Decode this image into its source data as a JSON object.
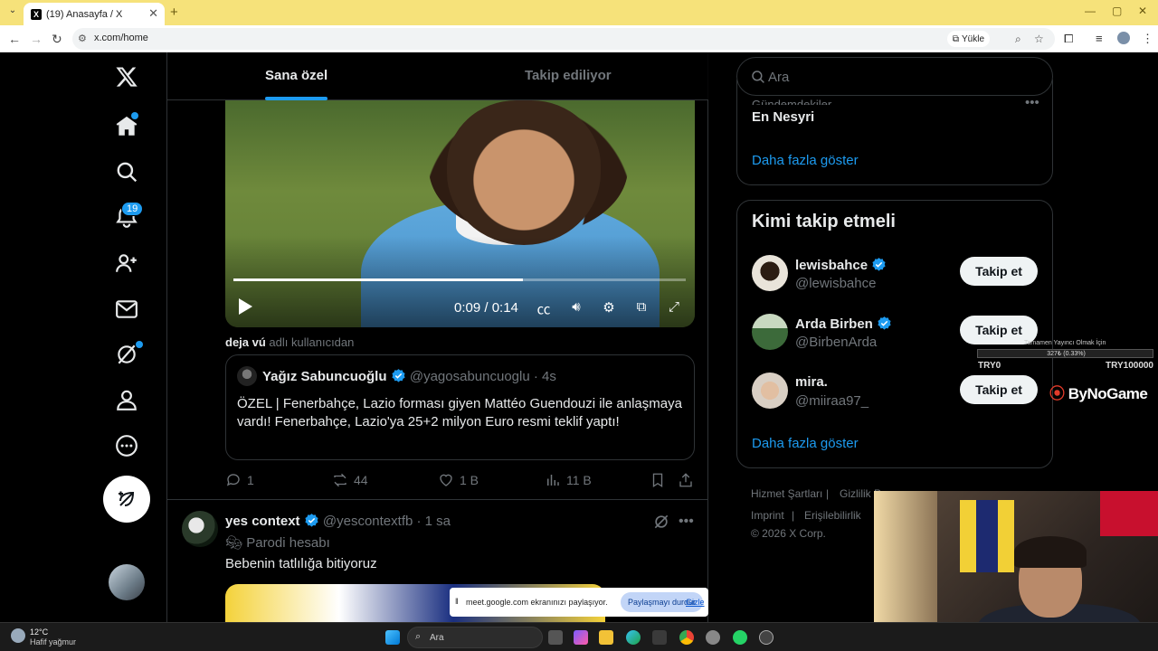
{
  "browser": {
    "tab_title": "(19) Anasayfa / X",
    "url": "x.com/home",
    "install_label": "Yükle"
  },
  "nav": {
    "notification_count": "19"
  },
  "feed": {
    "tabs": [
      "Sana özel",
      "Takip ediliyor"
    ],
    "video": {
      "time": "0:09 / 0:14",
      "progress": 0.64
    },
    "context_user": "deja vú",
    "context_suffix": "adlı kullanıcıdan",
    "quote": {
      "name": "Yağız Sabuncuoğlu",
      "handle": "@yagosabuncuoglu · 4s",
      "text": "ÖZEL | Fenerbahçe, Lazio forması giyen Mattéo Guendouzi ile anlaşmaya vardı! Fenerbahçe, Lazio'ya 25+2 milyon Euro resmi teklif yaptı!"
    },
    "actions": {
      "replies": "1",
      "reposts": "44",
      "likes": "1 B",
      "views": "11 B"
    },
    "tweet2": {
      "name": "yes context",
      "handle": "@yescontextfb · 1 sa",
      "parody_label": "Parodi hesabı",
      "text": "Bebenin tatlılığa bitiyoruz"
    }
  },
  "sidebar": {
    "search_placeholder": "Ara",
    "trend": {
      "category": "Gündemdekiler",
      "name": "En Nesyri",
      "show_more": "Daha fazla göster"
    },
    "who_to_follow": {
      "title": "Kimi takip etmeli",
      "users": [
        {
          "name": "lewisbahce",
          "handle": "@lewisbahce",
          "verified": true,
          "button": "Takip et"
        },
        {
          "name": "Arda Birben",
          "handle": "@BirbenArda",
          "verified": true,
          "button": "Takip et"
        },
        {
          "name": "mira.",
          "handle": "@miiraa97_",
          "verified": false,
          "button": "Takip et"
        }
      ],
      "show_more": "Daha fazla göster"
    },
    "footer": {
      "terms": "Hizmet Şartları",
      "privacy": "Gizlilik P",
      "imprint": "Imprint",
      "accessibility": "Erişilebilirlik",
      "copyright": "© 2026 X Corp."
    }
  },
  "overlay": {
    "stream_title": "Tamamen Yayıncı Olmak İçin",
    "stream_progress_text": "327₺ (0.33%)",
    "stream_min": "TRY0",
    "stream_max": "TRY100000",
    "brand": "ByNoGame"
  },
  "screenshare": {
    "text": "meet.google.com ekranınızı paylaşıyor.",
    "stop_label": "Paylaşmayı durdur",
    "hide_label": "Gizle"
  },
  "taskbar": {
    "weather_temp": "12°C",
    "weather_desc": "Hafif yağmur",
    "search_placeholder": "Ara"
  },
  "colors": {
    "accent": "#1d9bf0",
    "background": "#000000",
    "chrome_tabbar": "#f6e27a"
  }
}
